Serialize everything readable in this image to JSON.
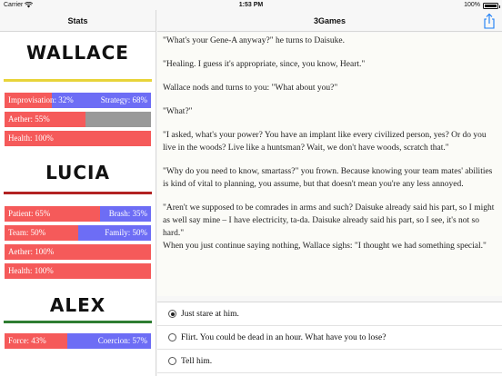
{
  "status_bar": {
    "carrier": "Carrier",
    "time": "1:53 PM",
    "battery": "100%"
  },
  "sidebar": {
    "title": "Stats",
    "characters": [
      {
        "name": "WALLACE",
        "rule_color": "#e8d43a",
        "stats": [
          {
            "left": "Improvisation: 32%",
            "right": "Strategy: 68%",
            "fill": 0.32,
            "fill_color": "#f55a5a",
            "bg_color": "#6d6df5"
          },
          {
            "left": "Aether: 55%",
            "right": "",
            "fill": 0.55,
            "fill_color": "#f55a5a",
            "bg_color": "#999999"
          },
          {
            "left": "Health: 100%",
            "right": "",
            "fill": 1.0,
            "fill_color": "#f55a5a",
            "bg_color": "#999999"
          }
        ]
      },
      {
        "name": "LUCIA",
        "rule_color": "#b22222",
        "stats": [
          {
            "left": "Patient: 65%",
            "right": "Brash: 35%",
            "fill": 0.65,
            "fill_color": "#f55a5a",
            "bg_color": "#6d6df5"
          },
          {
            "left": "Team: 50%",
            "right": "Family: 50%",
            "fill": 0.5,
            "fill_color": "#f55a5a",
            "bg_color": "#6d6df5"
          },
          {
            "left": "Aether: 100%",
            "right": "",
            "fill": 1.0,
            "fill_color": "#f55a5a",
            "bg_color": "#999999"
          },
          {
            "left": "Health: 100%",
            "right": "",
            "fill": 1.0,
            "fill_color": "#f55a5a",
            "bg_color": "#999999"
          }
        ]
      },
      {
        "name": "ALEX",
        "rule_color": "#2e7d32",
        "stats": [
          {
            "left": "Force: 43%",
            "right": "Coercion: 57%",
            "fill": 0.43,
            "fill_color": "#f55a5a",
            "bg_color": "#6d6df5"
          }
        ]
      }
    ]
  },
  "nav": {
    "title": "3Games"
  },
  "story": {
    "paragraphs": [
      "\"What's your Gene-A anyway?\" he turns to Daisuke.",
      "\"Healing. I guess it's appropriate, since, you know, Heart.\"",
      "Wallace nods and turns to you: \"What about you?\"",
      "\"What?\"",
      "\"I asked, what's your power? You have an implant like every civilized person, yes? Or do you live in the woods? Live like a huntsman? Wait, we don't have woods, scratch that.\"",
      "\"Why do you need to know, smartass?\" you frown. Because knowing your team mates' abilities is kind of vital to planning, you assume, but that doesn't mean you're any less annoyed.",
      "\"Aren't we supposed to be comrades in arms and such? Daisuke already said his part, so I might as well say mine – I have electricity, ta-da. Daisuke already said his part, so I see, it's not so hard.\"",
      "When you just continue saying nothing, Wallace sighs: \"I thought we had something special.\""
    ]
  },
  "choices": [
    {
      "label": "Just stare at him.",
      "selected": true
    },
    {
      "label": "Flirt. You could be dead in an hour. What have you to lose?",
      "selected": false
    },
    {
      "label": "Tell him.",
      "selected": false
    }
  ]
}
